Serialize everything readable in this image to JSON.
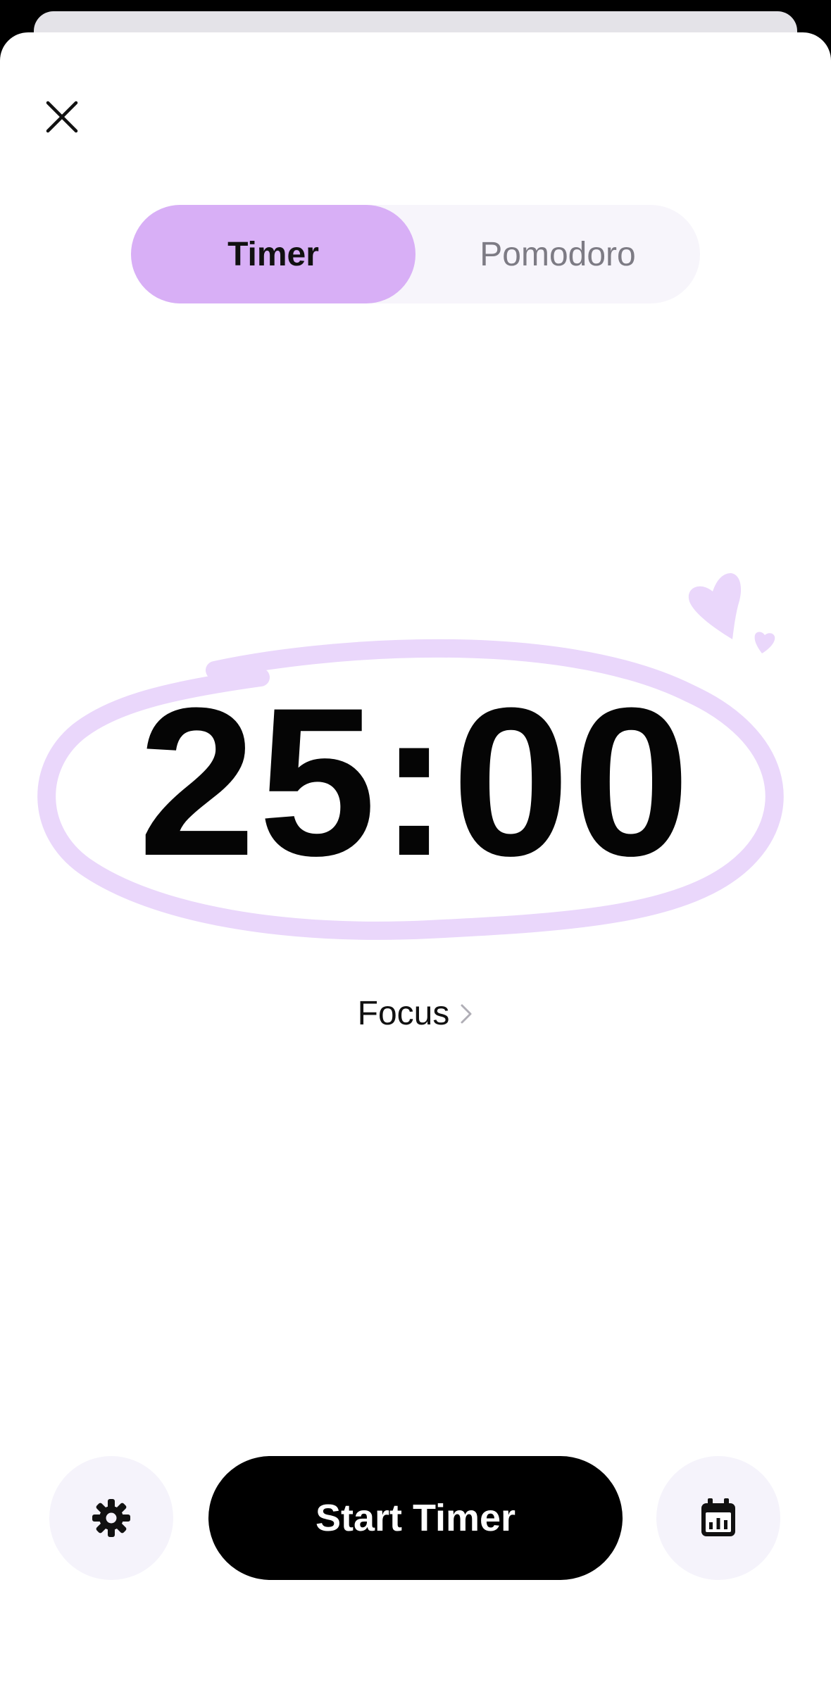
{
  "header": {
    "close_icon": "close-icon"
  },
  "mode_switch": {
    "tabs": [
      {
        "label": "Timer",
        "selected": true
      },
      {
        "label": "Pomodoro",
        "selected": false
      }
    ]
  },
  "timer": {
    "time": "25:00",
    "doodle_icon": "hearts-icon"
  },
  "session": {
    "label": "Focus",
    "icon": "chevron-right-icon"
  },
  "actions": {
    "settings_icon": "gear-icon",
    "start_label": "Start Timer",
    "stats_icon": "calendar-stats-icon"
  },
  "colors": {
    "accent": "#d8aff6",
    "accent_light": "#ead7fb",
    "segment_bg": "#f7f5fb",
    "round_button_bg": "#f5f3fb",
    "primary_button": "#000000"
  }
}
